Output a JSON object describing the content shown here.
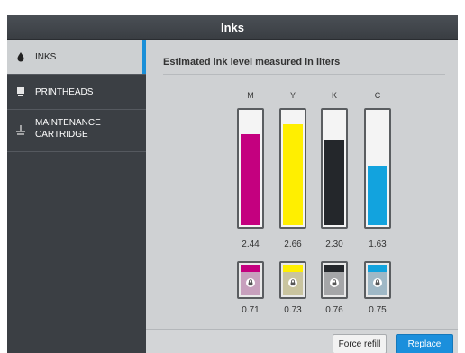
{
  "window": {
    "title": "Inks"
  },
  "sidebar": {
    "items": [
      {
        "label": "INKS",
        "icon": "ink-drop-icon",
        "active": true
      },
      {
        "label": "PRINTHEADS",
        "icon": "printhead-icon",
        "active": false
      },
      {
        "label_line1": "MAINTENANCE",
        "label_line2": "CARTRIDGE",
        "icon": "maintenance-cartridge-icon",
        "active": false
      }
    ]
  },
  "main": {
    "heading": "Estimated ink level measured in liters",
    "inks": [
      {
        "letter": "M",
        "level_fraction": 0.81,
        "value": "2.44",
        "cart_value": "0.71",
        "color": "#c4007f",
        "cart_tint": "#c7a0bd"
      },
      {
        "letter": "Y",
        "level_fraction": 0.89,
        "value": "2.66",
        "cart_value": "0.73",
        "color": "#ffef00",
        "cart_tint": "#c9c49f"
      },
      {
        "letter": "K",
        "level_fraction": 0.76,
        "value": "2.30",
        "cart_value": "0.76",
        "color": "#24272b",
        "cart_tint": "#a5a6a8"
      },
      {
        "letter": "C",
        "level_fraction": 0.54,
        "value": "1.63",
        "cart_value": "0.75",
        "color": "#12a3de",
        "cart_tint": "#9fb8c6"
      }
    ]
  },
  "footer": {
    "force_refill_label": "Force refill",
    "replace_label": "Replace"
  },
  "colors": {
    "accent": "#1a8fd8"
  }
}
